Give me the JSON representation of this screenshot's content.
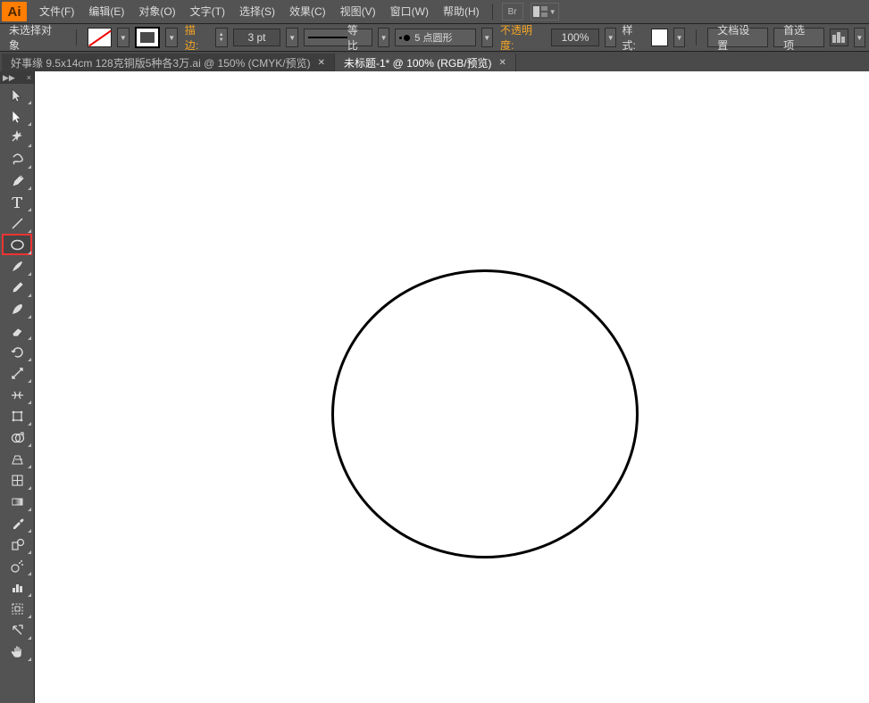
{
  "app_logo_text": "Ai",
  "menu": {
    "file": "文件(F)",
    "edit": "编辑(E)",
    "object": "对象(O)",
    "text": "文字(T)",
    "select": "选择(S)",
    "effect": "效果(C)",
    "view": "视图(V)",
    "window": "窗口(W)",
    "help": "帮助(H)"
  },
  "bridge_label": "Br",
  "control": {
    "status": "未选择对象",
    "stroke_label": "描边:",
    "stroke_pt": "3 pt",
    "uniform": "等比",
    "brush_label": "5 点圆形",
    "opacity_label": "不透明度:",
    "opacity_value": "100%",
    "style_label": "样式:",
    "doc_setup": "文档设置",
    "preferences": "首选项"
  },
  "tabs": [
    {
      "label": "好事缘  9.5x14cm    128克铜版5种各3万.ai @ 150% (CMYK/预览)",
      "active": false
    },
    {
      "label": "未标题-1* @ 100% (RGB/预览)",
      "active": true
    }
  ],
  "tool_header": "▶▶",
  "tools": [
    {
      "name": "selection-tool",
      "icon": "cursor"
    },
    {
      "name": "direct-selection-tool",
      "icon": "cursor2"
    },
    {
      "name": "magic-wand-tool",
      "icon": "wand"
    },
    {
      "name": "lasso-tool",
      "icon": "lasso"
    },
    {
      "name": "pen-tool",
      "icon": "pen"
    },
    {
      "name": "type-tool",
      "icon": "type"
    },
    {
      "name": "line-tool",
      "icon": "line"
    },
    {
      "name": "ellipse-tool",
      "icon": "ellipse",
      "selected": true
    },
    {
      "name": "paintbrush-tool",
      "icon": "brush"
    },
    {
      "name": "pencil-tool",
      "icon": "pencil"
    },
    {
      "name": "blob-brush-tool",
      "icon": "blob"
    },
    {
      "name": "eraser-tool",
      "icon": "eraser"
    },
    {
      "name": "rotate-tool",
      "icon": "rotate"
    },
    {
      "name": "scale-tool",
      "icon": "scale"
    },
    {
      "name": "width-tool",
      "icon": "width"
    },
    {
      "name": "free-transform-tool",
      "icon": "transform"
    },
    {
      "name": "shape-builder-tool",
      "icon": "shapebuild"
    },
    {
      "name": "perspective-grid-tool",
      "icon": "perspective"
    },
    {
      "name": "mesh-tool",
      "icon": "mesh"
    },
    {
      "name": "gradient-tool",
      "icon": "gradient"
    },
    {
      "name": "eyedropper-tool",
      "icon": "eyedrop"
    },
    {
      "name": "blend-tool",
      "icon": "blend"
    },
    {
      "name": "symbol-sprayer-tool",
      "icon": "spray"
    },
    {
      "name": "column-graph-tool",
      "icon": "graph"
    },
    {
      "name": "artboard-tool",
      "icon": "artboard"
    },
    {
      "name": "slice-tool",
      "icon": "slice"
    },
    {
      "name": "hand-tool",
      "icon": "hand"
    }
  ]
}
